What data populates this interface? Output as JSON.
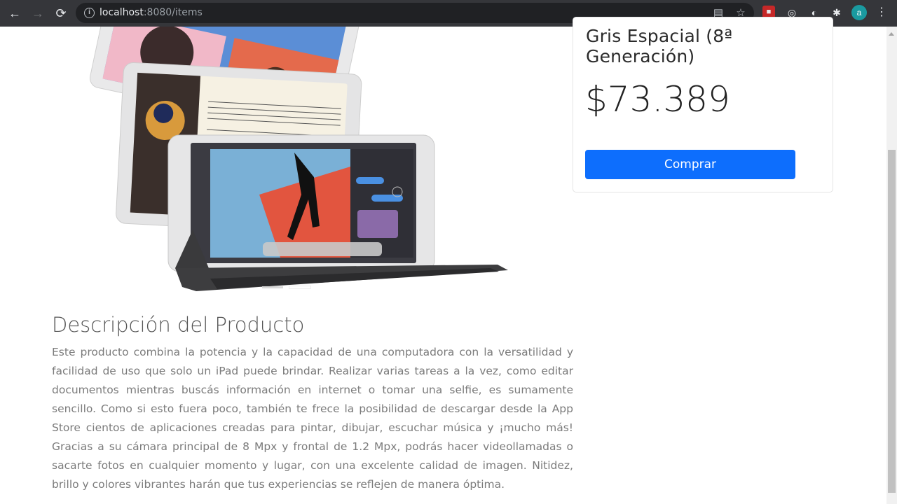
{
  "browser": {
    "url_host": "localhost",
    "url_rest": ":8080/items",
    "avatar_letter": "a"
  },
  "product": {
    "title": "Gris Espacial (8ª Generación)",
    "price": "$73.389",
    "buy_label": "Comprar"
  },
  "description": {
    "heading": "Descripción del Producto",
    "body": "Este producto combina la potencia y la capacidad de una computadora con la versatilidad y facilidad de uso que solo un iPad puede brindar. Realizar varias tareas a la vez, como editar documentos mientras buscás información en internet o tomar una selfie, es sumamente sencillo. Como si esto fuera poco, también te frece la posibilidad de descargar desde la App Store cientos de aplicaciones creadas para pintar, dibujar, escuchar música y ¡mucho más! Gracias a su cámara principal de 8 Mpx y frontal de 1.2 Mpx, podrás hacer videollamadas o sacarte fotos en cualquier momento y lugar, con una excelente calidad de imagen. Nitidez, brillo y colores vibrantes harán que tus experiencias se reflejen de manera óptima."
  },
  "colors": {
    "button": "#0d6efd",
    "chrome": "#35363a"
  }
}
